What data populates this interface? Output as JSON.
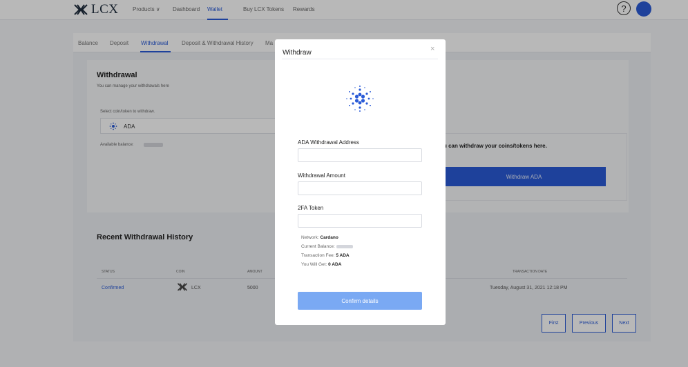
{
  "topnav": {
    "logo_text": "LCX",
    "links": [
      "Products ∨",
      "Dashboard",
      "Wallet",
      "Buy LCX Tokens",
      "Rewards"
    ],
    "help_label": "?"
  },
  "subtabs": [
    "Balance",
    "Deposit",
    "Withdrawal",
    "Deposit & Withdrawal History",
    "Ma"
  ],
  "withdrawal": {
    "title": "Withdrawal",
    "subtitle": "You can manage your withdrawals here",
    "select_label": "Select coin/token to withdraw.",
    "selected_coin": "ADA",
    "available_balance_label": "Available balance:"
  },
  "right_panel": {
    "text": "u can withdraw your coins/tokens here.",
    "button_label": "Withdraw ADA"
  },
  "history": {
    "title": "Recent Withdrawal History",
    "columns": [
      "STATUS",
      "COIN",
      "AMOUNT",
      "TRANSACTION DATE"
    ],
    "row": {
      "status": "Confirmed",
      "coin": "LCX",
      "amount": "5000",
      "date": "Tuesday, August 31, 2021 12:18 PM"
    }
  },
  "pagination": [
    "First",
    "Previous",
    "Next"
  ],
  "modal": {
    "title": "Withdraw",
    "close_label": "×",
    "address_label": "ADA Withdrawal Address",
    "amount_label": "Withdrawal Amount",
    "token_label": "2FA Token",
    "network_label": "Network:",
    "network_value": "Cardano",
    "balance_label": "Current Balance:",
    "fee_label": "Transaction Fee:",
    "fee_value": "5 ADA",
    "get_label": "You Will Get:",
    "get_value": "0 ADA",
    "confirm_label": "Confirm details"
  },
  "colors": {
    "accent": "#2a5bd7",
    "confirm_button": "#7aa9f3"
  }
}
